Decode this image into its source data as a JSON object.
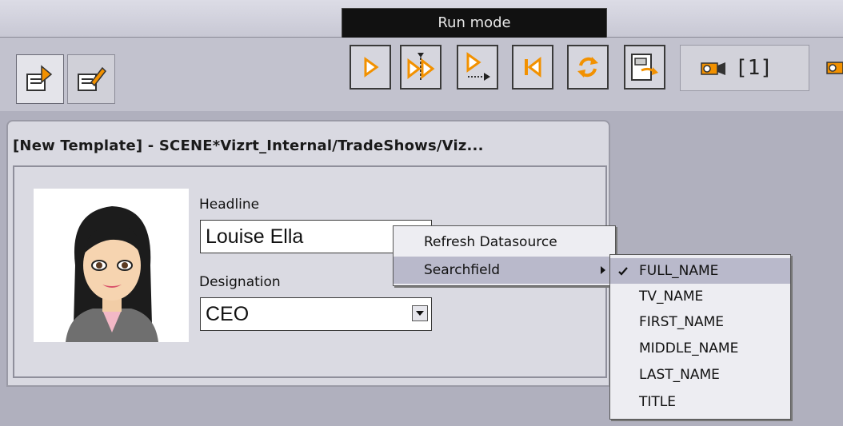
{
  "header": {
    "mode_title": "Run mode"
  },
  "toolbar": {
    "left_buttons": [
      {
        "name": "run-edit-icon"
      },
      {
        "name": "edit-template-icon"
      }
    ],
    "buttons": [
      {
        "name": "play-icon"
      },
      {
        "name": "step-play-icon"
      },
      {
        "name": "play-to-end-icon"
      },
      {
        "name": "rewind-icon"
      },
      {
        "name": "refresh-icon"
      },
      {
        "name": "export-icon"
      }
    ],
    "camera_label": "[1]",
    "accent_color": "#f29100"
  },
  "panel": {
    "title": "[New Template] - SCENE*Vizrt_Internal/TradeShows/Viz...",
    "headline_label": "Headline",
    "headline_value": "Louise Ella",
    "designation_label": "Designation",
    "designation_value": "CEO"
  },
  "context_menu": {
    "items": [
      {
        "label": "Refresh Datasource"
      },
      {
        "label": "Searchfield",
        "has_submenu": true,
        "highlighted": true
      }
    ]
  },
  "submenu": {
    "items": [
      {
        "label": "FULL_NAME",
        "checked": true,
        "highlighted": true
      },
      {
        "label": "TV_NAME"
      },
      {
        "label": "FIRST_NAME"
      },
      {
        "label": "MIDDLE_NAME"
      },
      {
        "label": "LAST_NAME"
      },
      {
        "label": "TITLE"
      }
    ]
  }
}
